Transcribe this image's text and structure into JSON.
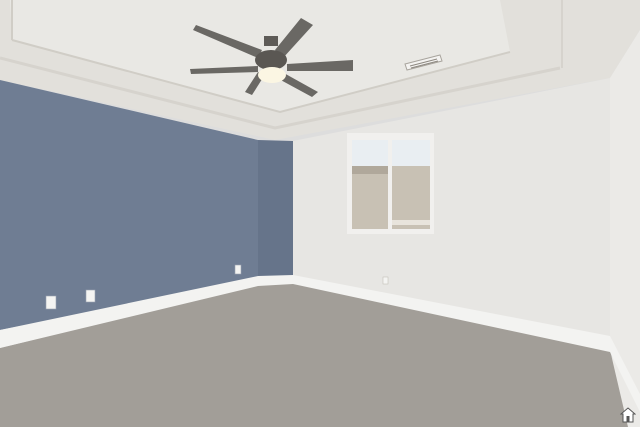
{
  "scene": {
    "subject": "empty-bedroom",
    "colors": {
      "accent_wall": "#6f7d93",
      "accent_wall_shade": "#66748a",
      "white_wall": "#e7e6e3",
      "right_wall": "#ebeae7",
      "ceiling": "#e2e0db",
      "tray_ceiling": "#e9e8e4",
      "carpet": "#a29e98",
      "baseboard": "#f3f3f1",
      "fan_blade": "#6a6864",
      "fan_light": "#fbf6e3",
      "window_view": "#c8c1b4",
      "window_sky": "#e9eef2"
    },
    "icons": [
      "ceiling-fan-icon",
      "air-vent-icon",
      "window-icon",
      "wall-outlet-icon",
      "home-watermark-icon"
    ]
  }
}
